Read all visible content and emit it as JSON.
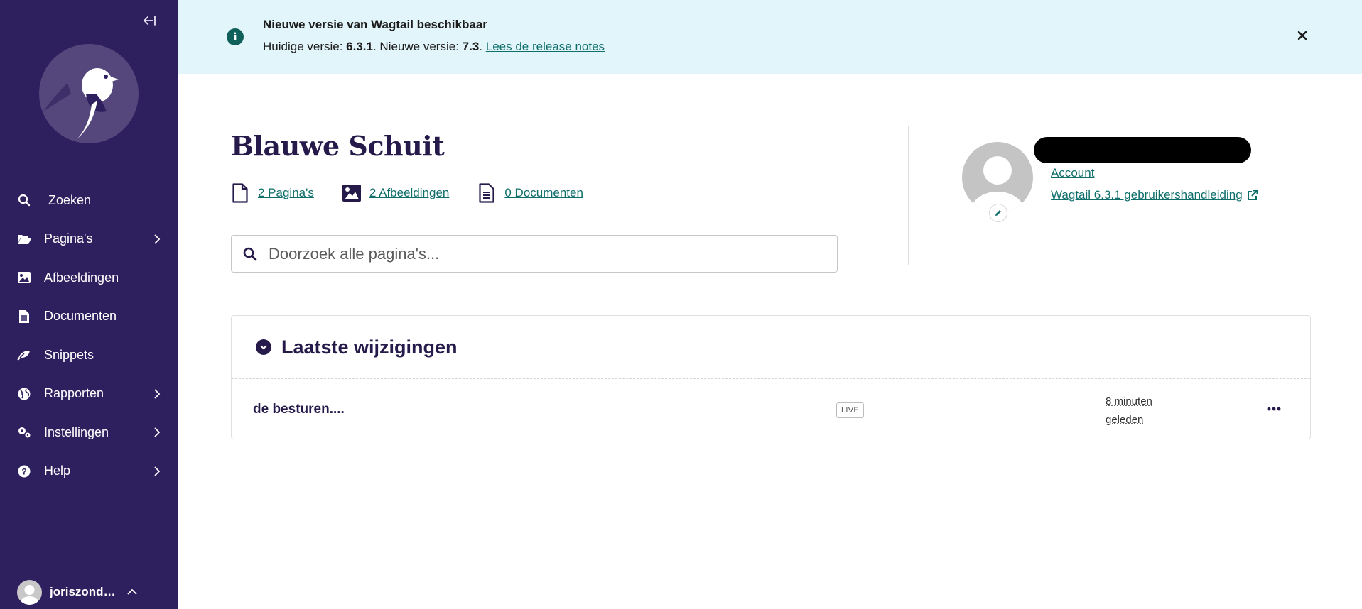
{
  "sidebar": {
    "collapse_label": "←I",
    "items": [
      {
        "label": "Zoeken",
        "icon": "search-icon"
      },
      {
        "label": "Pagina's",
        "icon": "folder-open-icon",
        "has_children": true
      },
      {
        "label": "Afbeeldingen",
        "icon": "image-icon"
      },
      {
        "label": "Documenten",
        "icon": "document-icon"
      },
      {
        "label": "Snippets",
        "icon": "snippet-icon"
      },
      {
        "label": "Rapporten",
        "icon": "globe-icon",
        "has_children": true
      },
      {
        "label": "Instellingen",
        "icon": "cogs-icon",
        "has_children": true
      },
      {
        "label": "Help",
        "icon": "help-icon",
        "has_children": true
      }
    ],
    "user": {
      "name": "joriszondervan..."
    }
  },
  "banner": {
    "title": "Nieuwe versie van Wagtail beschikbaar",
    "current_label": "Huidige versie: ",
    "current_version": "6.3.1",
    "new_label": ". Nieuwe versie: ",
    "new_version": "7.3",
    "sep": ". ",
    "link": "Lees de release notes"
  },
  "main": {
    "site_title": "Blauwe Schuit",
    "summary": [
      {
        "label": "2 Pagina's",
        "icon": "page-icon"
      },
      {
        "label": "2 Afbeeldingen",
        "icon": "image-icon"
      },
      {
        "label": "0 Documenten",
        "icon": "doc-icon"
      }
    ],
    "search_placeholder": "Doorzoek alle pagina's..."
  },
  "profile": {
    "account_link": "Account",
    "guide_link": "Wagtail 6.3.1 gebruikershandleiding"
  },
  "panel": {
    "title": "Laatste wijzigingen",
    "rows": [
      {
        "title": "de besturen....",
        "status": "LIVE",
        "time_line1": "8 minuten",
        "time_line2": "geleden"
      }
    ]
  },
  "colors": {
    "sidebar_bg": "#2e1f5e",
    "banner_bg": "#e2f5fb",
    "link": "#0f6e6a",
    "heading": "#261a4b"
  }
}
